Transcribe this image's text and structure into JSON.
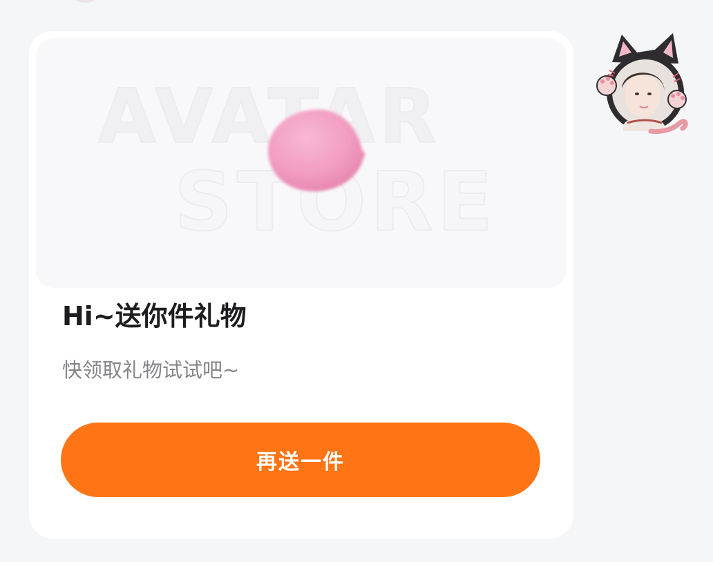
{
  "card": {
    "banner_watermark_line1": "AVATAR",
    "banner_watermark_line2": "STORE",
    "title": "Hi~送你件礼物",
    "subtitle": "快领取礼物试试吧~",
    "button_label": "再送一件"
  },
  "avatar": {
    "icon": "cat-frame-avatar-icon"
  },
  "colors": {
    "accent": "#ff7414",
    "card_bg": "#ffffff",
    "page_bg": "#f5f6f8",
    "title": "#1d1d1f",
    "subtitle": "#858589",
    "gift": "#f3a0c4"
  }
}
